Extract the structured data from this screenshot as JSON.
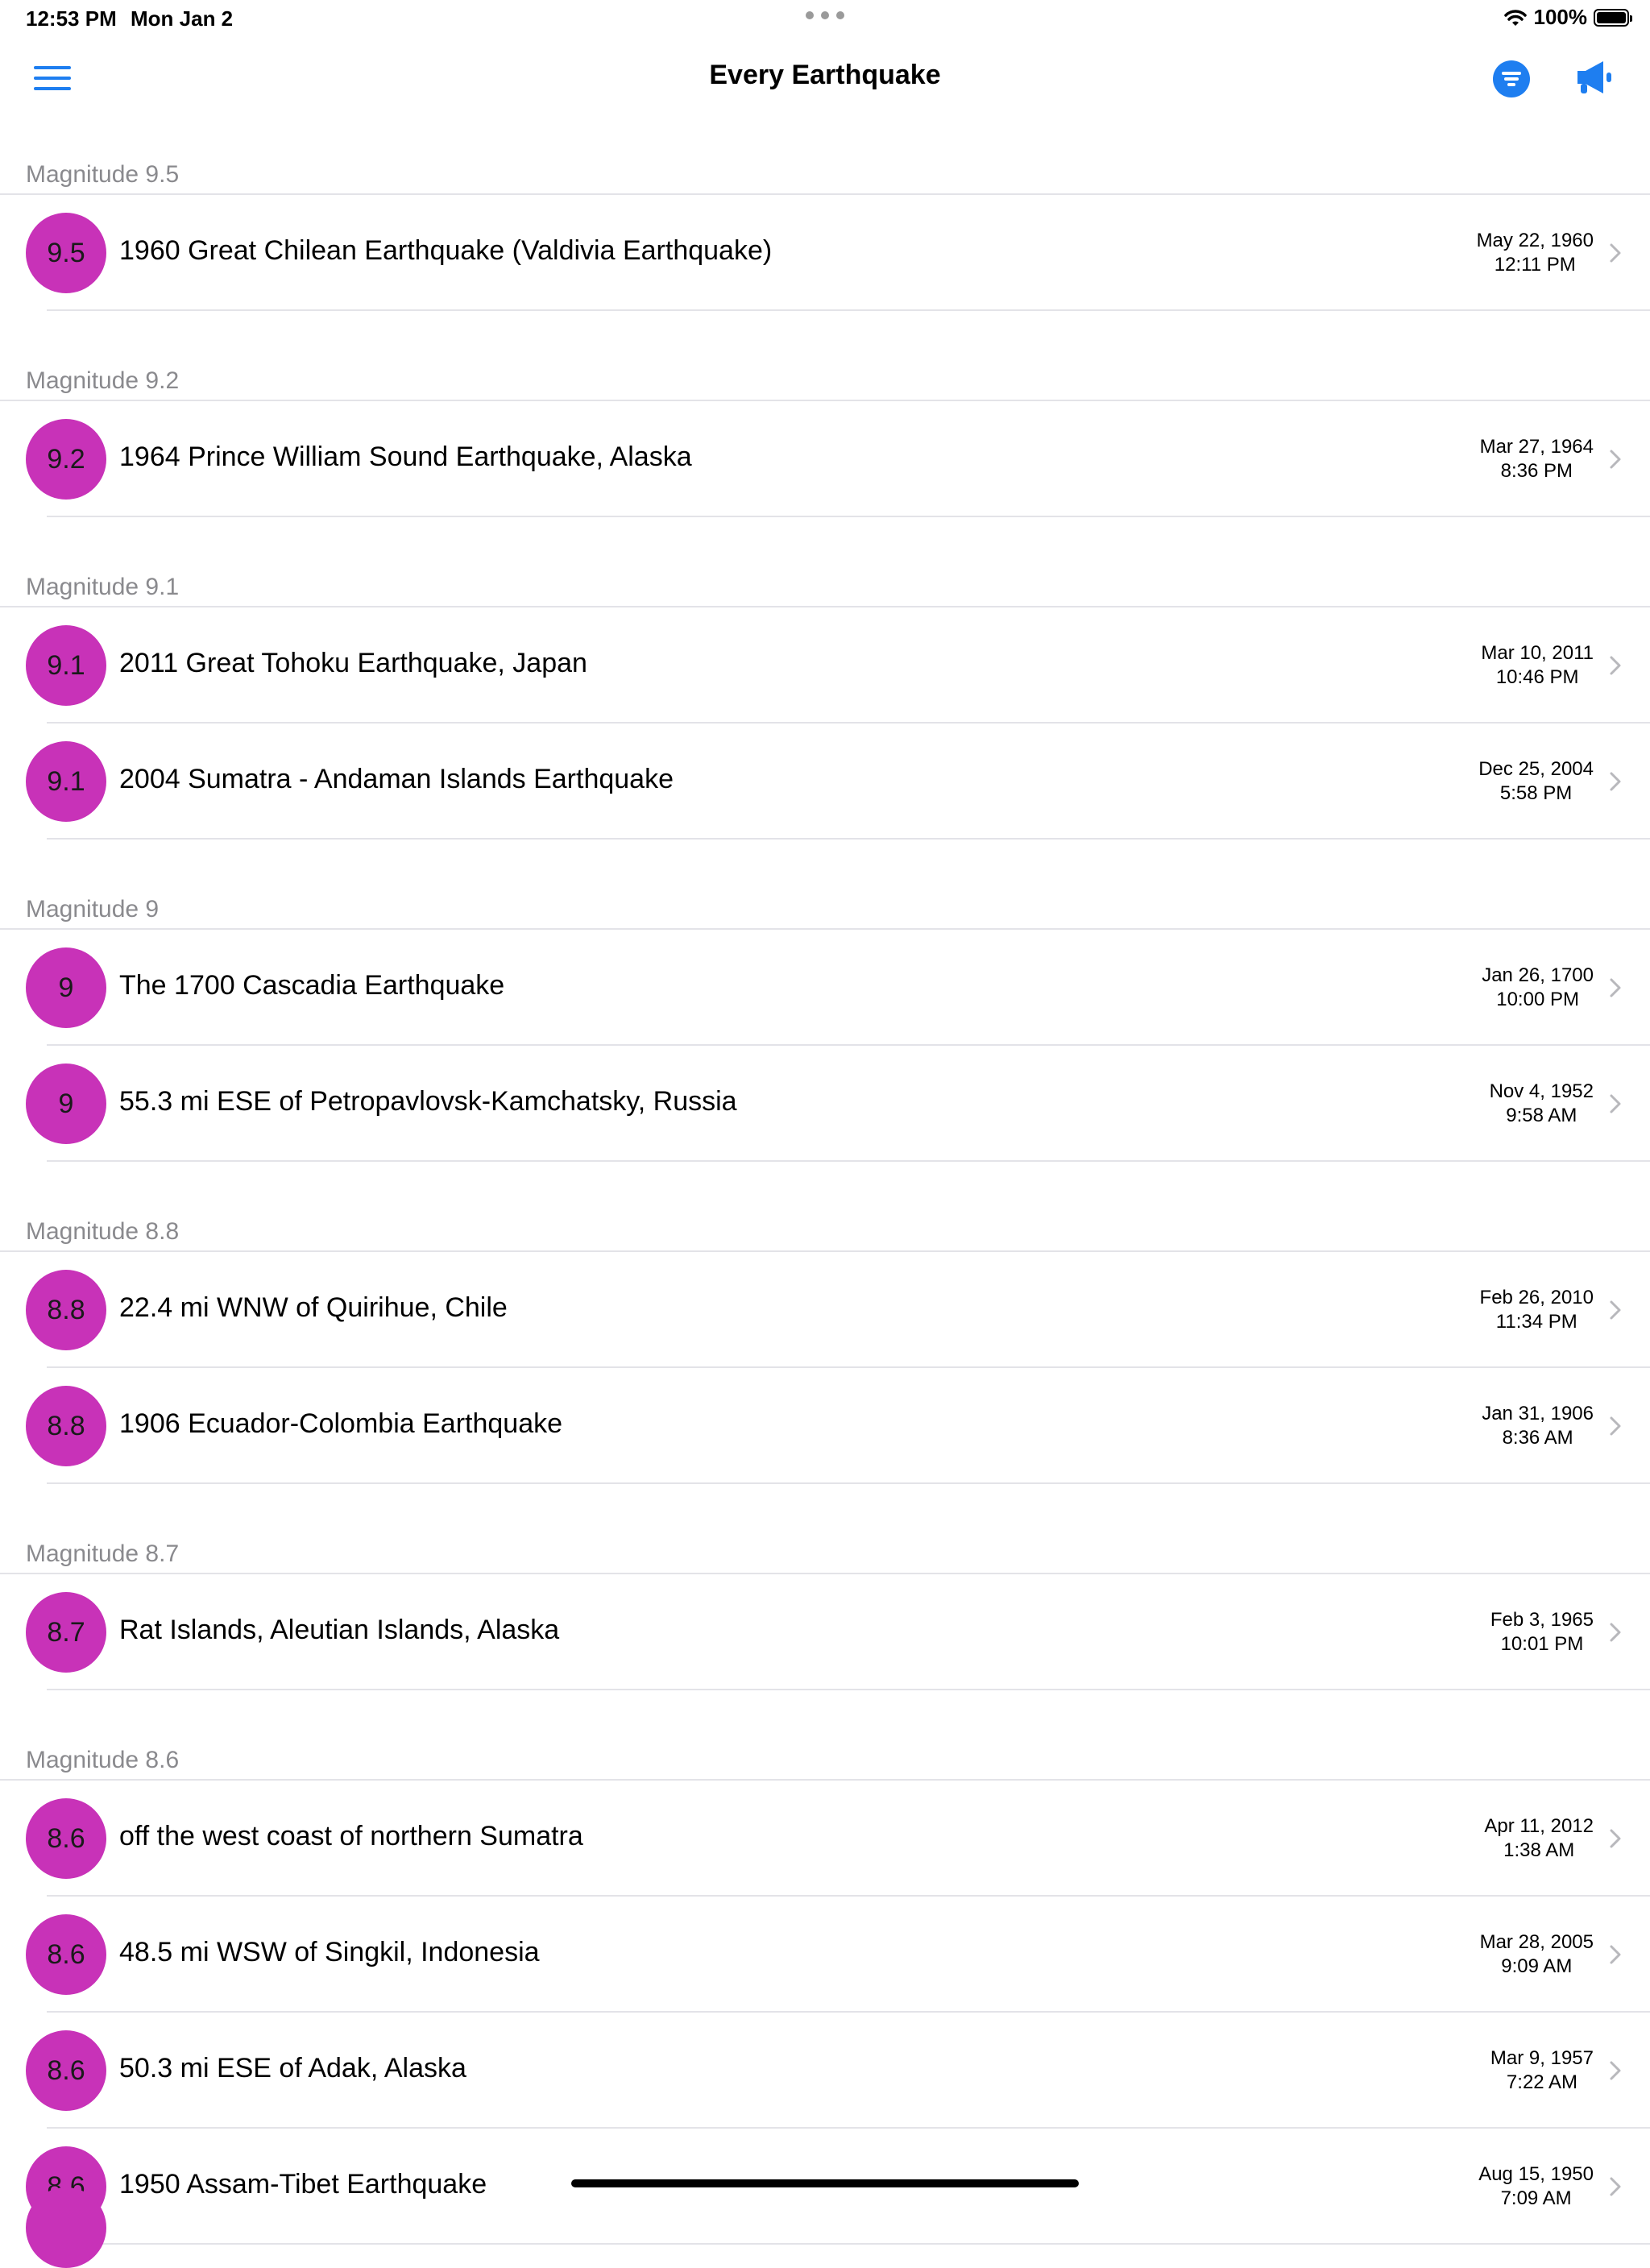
{
  "status": {
    "time": "12:53 PM",
    "date": "Mon Jan 2",
    "battery": "100%"
  },
  "nav": {
    "title": "Every Earthquake"
  },
  "colors": {
    "accent": "#1e7ef0",
    "badge": "#c832b8"
  },
  "icons": {
    "menu": "hamburger-icon",
    "filter": "filter-icon",
    "announce": "megaphone-icon",
    "chevron": "chevron-right-icon"
  },
  "sections": [
    {
      "header": "Magnitude 9.5",
      "items": [
        {
          "mag": "9.5",
          "title": "1960 Great Chilean Earthquake (Valdivia Earthquake)",
          "date": "May 22, 1960",
          "time": "12:11 PM"
        }
      ]
    },
    {
      "header": "Magnitude 9.2",
      "items": [
        {
          "mag": "9.2",
          "title": "1964 Prince William Sound Earthquake, Alaska",
          "date": "Mar 27, 1964",
          "time": "8:36 PM"
        }
      ]
    },
    {
      "header": "Magnitude 9.1",
      "items": [
        {
          "mag": "9.1",
          "title": "2011 Great Tohoku Earthquake, Japan",
          "date": "Mar 10, 2011",
          "time": "10:46 PM"
        },
        {
          "mag": "9.1",
          "title": "2004 Sumatra - Andaman Islands Earthquake",
          "date": "Dec 25, 2004",
          "time": "5:58 PM"
        }
      ]
    },
    {
      "header": "Magnitude 9",
      "items": [
        {
          "mag": "9",
          "title": "The 1700 Cascadia Earthquake",
          "date": "Jan 26, 1700",
          "time": "10:00 PM"
        },
        {
          "mag": "9",
          "title": "55.3 mi ESE of Petropavlovsk-Kamchatsky, Russia",
          "date": "Nov 4, 1952",
          "time": "9:58 AM"
        }
      ]
    },
    {
      "header": "Magnitude 8.8",
      "items": [
        {
          "mag": "8.8",
          "title": "22.4 mi WNW of Quirihue, Chile",
          "date": "Feb 26, 2010",
          "time": "11:34 PM"
        },
        {
          "mag": "8.8",
          "title": "1906 Ecuador-Colombia Earthquake",
          "date": "Jan 31, 1906",
          "time": "8:36 AM"
        }
      ]
    },
    {
      "header": "Magnitude 8.7",
      "items": [
        {
          "mag": "8.7",
          "title": "Rat Islands, Aleutian Islands, Alaska",
          "date": "Feb 3, 1965",
          "time": "10:01 PM"
        }
      ]
    },
    {
      "header": "Magnitude 8.6",
      "items": [
        {
          "mag": "8.6",
          "title": "off the west coast of northern Sumatra",
          "date": "Apr 11, 2012",
          "time": "1:38 AM"
        },
        {
          "mag": "8.6",
          "title": "48.5 mi WSW of Singkil, Indonesia",
          "date": "Mar 28, 2005",
          "time": "9:09 AM"
        },
        {
          "mag": "8.6",
          "title": "50.3 mi ESE of Adak, Alaska",
          "date": "Mar 9, 1957",
          "time": "7:22 AM"
        },
        {
          "mag": "8.6",
          "title": "1950 Assam-Tibet Earthquake",
          "date": "Aug 15, 1950",
          "time": "7:09 AM"
        }
      ]
    }
  ]
}
